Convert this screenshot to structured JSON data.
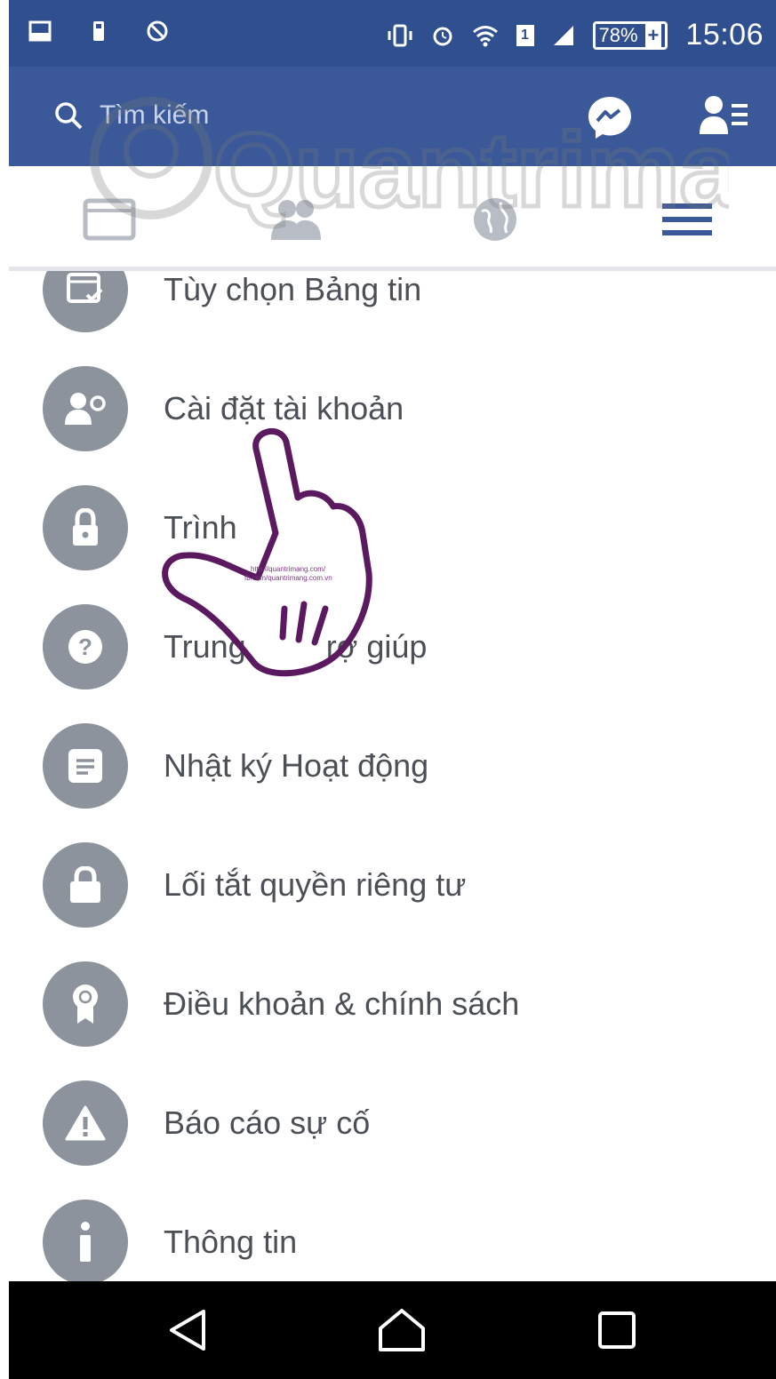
{
  "status_bar": {
    "battery": "78%",
    "time": "15:06",
    "sim": "1"
  },
  "header": {
    "search_placeholder": "Tìm kiếm"
  },
  "tabs": [
    {
      "name": "news-feed"
    },
    {
      "name": "friends"
    },
    {
      "name": "notifications"
    },
    {
      "name": "menu"
    }
  ],
  "menu": {
    "items": [
      {
        "label": "Tùy chọn Bảng tin",
        "icon": "news-feed-settings-icon"
      },
      {
        "label": "Cài đặt tài khoản",
        "icon": "account-settings-icon"
      },
      {
        "label": "Trình",
        "icon": "lock-icon"
      },
      {
        "label": "Trung",
        "label_tail": "rợ giúp",
        "icon": "help-icon"
      },
      {
        "label": "Nhật ký Hoạt động",
        "icon": "activity-log-icon"
      },
      {
        "label": "Lối tắt quyền riêng tư",
        "icon": "privacy-lock-icon"
      },
      {
        "label": "Điều khoản & chính sách",
        "icon": "terms-badge-icon"
      },
      {
        "label": "Báo cáo sự cố",
        "icon": "warning-icon"
      },
      {
        "label": "Thông tin",
        "icon": "info-icon"
      }
    ]
  },
  "watermark": {
    "text": "Quantrimang",
    "pointer_caption_1": "http://quantrimang.com/",
    "pointer_caption_2": "fb.com/quantrimang.com.vn"
  },
  "colors": {
    "status_bar": "#2f4f8f",
    "header": "#3b5998",
    "icon_circle": "#8d939d",
    "label_text": "#4b4f56",
    "pointer": "#5b1a5f"
  }
}
